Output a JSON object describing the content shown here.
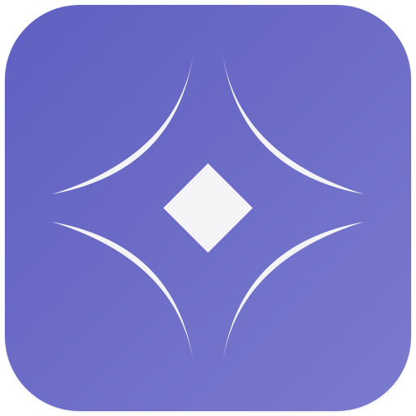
{
  "icon": {
    "background_gradient": [
      "#5f5fc1",
      "#7a7bcd"
    ],
    "glyph_color": "#f4f4f7",
    "glyph": "four-curved-petals-with-center-diamond"
  }
}
